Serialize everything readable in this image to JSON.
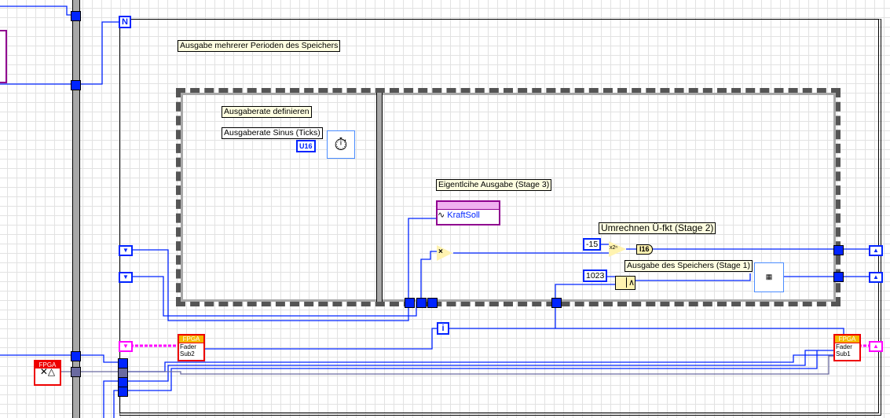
{
  "loop": {
    "count_terminal": "N",
    "iteration_terminal": "i"
  },
  "comments": {
    "loop_title": "Ausgabe mehrerer Perioden des Speichers",
    "frame1": "Ausgaberate definieren",
    "stage3": "Eigentlcihe Ausgabe (Stage 3)",
    "stage2": "Umrechnen Ü-fkt (Stage 2)",
    "stage1": "Ausgabe des Speichers (Stage 1)"
  },
  "labels": {
    "rate": "Ausgaberate Sinus (Ticks)"
  },
  "constants": {
    "u16": "U16",
    "minus15": "-15",
    "c1023": "1023",
    "i16": "I16"
  },
  "nodes": {
    "kraftsoll": "KraftSoll",
    "fpga_header": "FPGA",
    "fader_sub2": [
      "Fader",
      "Sub2"
    ],
    "fader_sub1": [
      "Fader",
      "Sub1"
    ],
    "multiply": "×",
    "scale": "x2ⁿ",
    "and": "∧"
  },
  "colors": {
    "wire": "#0024ff",
    "cluster": "#ff00ff",
    "fpga": "#e00000"
  }
}
